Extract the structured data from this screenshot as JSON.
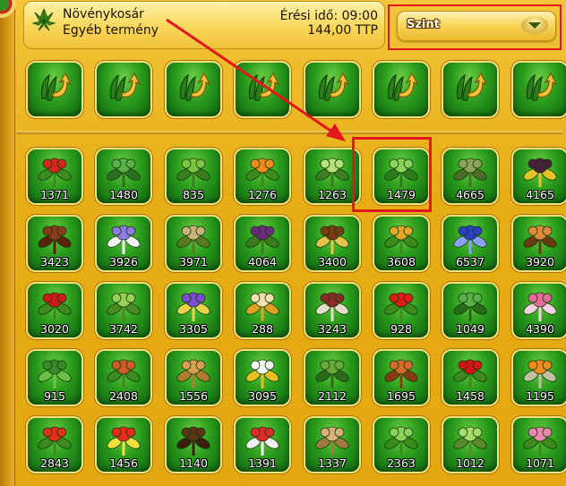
{
  "header": {
    "title": "Növénykosár",
    "subtitle": "Egyéb termény",
    "time_text": "Érési idő: 09:00",
    "price_text": "144,00 TTP"
  },
  "level_select": {
    "label": "Szint"
  },
  "top_row": [
    {
      "icon": "seed-collect-icon"
    },
    {
      "icon": "seed-collect-icon"
    },
    {
      "icon": "seed-collect-icon"
    },
    {
      "icon": "seed-collect-icon"
    },
    {
      "icon": "seed-collect-icon"
    },
    {
      "icon": "seed-collect-icon"
    },
    {
      "icon": "seed-collect-icon"
    },
    {
      "icon": "seed-collect-icon"
    }
  ],
  "plants": [
    {
      "count": "1371",
      "icon": "red-berry-plant-icon",
      "c1": "#d6261c",
      "c2": "#3e8a1e"
    },
    {
      "count": "1480",
      "icon": "spiky-agave-icon",
      "c1": "#5bb04a",
      "c2": "#2c6e22"
    },
    {
      "count": "835",
      "icon": "leafy-herb-icon",
      "c1": "#7fc443",
      "c2": "#3c7e1f"
    },
    {
      "count": "1276",
      "icon": "marigold-icon",
      "c1": "#f08a18",
      "c2": "#3e8a1e"
    },
    {
      "count": "1263",
      "icon": "mint-icon",
      "c1": "#b6e07a",
      "c2": "#3c7e1f"
    },
    {
      "count": "1479",
      "icon": "basil-icon",
      "c1": "#8cd35c",
      "c2": "#2f7a1a"
    },
    {
      "count": "4665",
      "icon": "cane-stalk-icon",
      "c1": "#8ea45a",
      "c2": "#4d6b2a"
    },
    {
      "count": "4165",
      "icon": "passion-fruit-icon",
      "c1": "#4a1e3c",
      "c2": "#e3c12a"
    },
    {
      "count": "3423",
      "icon": "cinnamon-icon",
      "c1": "#8a3a1a",
      "c2": "#5a220d"
    },
    {
      "count": "3926",
      "icon": "iris-flower-icon",
      "c1": "#8e7ae0",
      "c2": "#f2f2f2"
    },
    {
      "count": "3971",
      "icon": "vanilla-pod-icon",
      "c1": "#c9b27a",
      "c2": "#5a7a22"
    },
    {
      "count": "4064",
      "icon": "grape-vine-icon",
      "c1": "#6a2a80",
      "c2": "#3e7a1e"
    },
    {
      "count": "3400",
      "icon": "star-anise-icon",
      "c1": "#7a3a12",
      "c2": "#e7c24a"
    },
    {
      "count": "3608",
      "icon": "pineapple-icon",
      "c1": "#e0a628",
      "c2": "#3e8a1e"
    },
    {
      "count": "6537",
      "icon": "blue-flower-icon",
      "c1": "#2a3fc2",
      "c2": "#8aa0f0"
    },
    {
      "count": "3920",
      "icon": "ginseng-root-icon",
      "c1": "#e08a3a",
      "c2": "#6a3a12"
    },
    {
      "count": "3020",
      "icon": "red-chili-bunch-icon",
      "c1": "#d3181c",
      "c2": "#3e8a1e"
    },
    {
      "count": "3742",
      "icon": "green-pod-icon",
      "c1": "#9ad05a",
      "c2": "#4c8a22"
    },
    {
      "count": "3305",
      "icon": "purple-orchid-icon",
      "c1": "#7a4ad0",
      "c2": "#e6d24a"
    },
    {
      "count": "288",
      "icon": "chamomile-icon",
      "c1": "#f7e0b0",
      "c2": "#e0a020"
    },
    {
      "count": "3243",
      "icon": "nutmeg-icon",
      "c1": "#8a2a2a",
      "c2": "#e6dccc"
    },
    {
      "count": "928",
      "icon": "red-pepper-icon",
      "c1": "#e01a14",
      "c2": "#3e8a1e"
    },
    {
      "count": "1049",
      "icon": "aloe-icon",
      "c1": "#5ab04a",
      "c2": "#2a6a1a"
    },
    {
      "count": "4390",
      "icon": "pink-protea-icon",
      "c1": "#e86a9a",
      "c2": "#f4d0e0"
    },
    {
      "count": "915",
      "icon": "pine-sprig-icon",
      "c1": "#3a8a2a",
      "c2": "#6cc04a"
    },
    {
      "count": "2408",
      "icon": "beetroot-icon",
      "c1": "#d05a2a",
      "c2": "#3e8a1e"
    },
    {
      "count": "1556",
      "icon": "ginger-root-icon",
      "c1": "#d7a050",
      "c2": "#b07a30"
    },
    {
      "count": "3095",
      "icon": "white-daisy-icon",
      "c1": "#f8f8f8",
      "c2": "#e8c020"
    },
    {
      "count": "2112",
      "icon": "bitter-gourd-icon",
      "c1": "#6aaa3a",
      "c2": "#2e6a1a"
    },
    {
      "count": "1695",
      "icon": "sweet-potato-icon",
      "c1": "#d56a2a",
      "c2": "#8a3a12"
    },
    {
      "count": "1458",
      "icon": "red-bell-pepper-icon",
      "c1": "#d5141a",
      "c2": "#3e8a1e"
    },
    {
      "count": "1195",
      "icon": "physalis-icon",
      "c1": "#f08a1a",
      "c2": "#c0c0a0"
    },
    {
      "count": "2843",
      "icon": "red-tulip-icon",
      "c1": "#e0301a",
      "c2": "#3e8a1e"
    },
    {
      "count": "1456",
      "icon": "hibiscus-icon",
      "c1": "#e82a1a",
      "c2": "#f0e040"
    },
    {
      "count": "1140",
      "icon": "coffee-bean-icon",
      "c1": "#5a3416",
      "c2": "#3a200c"
    },
    {
      "count": "1391",
      "icon": "red-mushroom-icon",
      "c1": "#e02a2a",
      "c2": "#f0f0f0"
    },
    {
      "count": "1337",
      "icon": "ginger-knob-icon",
      "c1": "#d9b07a",
      "c2": "#a07a40"
    },
    {
      "count": "2363",
      "icon": "green-sprout-icon",
      "c1": "#8ad05a",
      "c2": "#3e8a1e"
    },
    {
      "count": "1012",
      "icon": "lemongrass-icon",
      "c1": "#aadc6a",
      "c2": "#5a8a2a"
    },
    {
      "count": "1071",
      "icon": "pink-blossom-icon",
      "c1": "#e88ab0",
      "c2": "#3e8a1e"
    }
  ]
}
